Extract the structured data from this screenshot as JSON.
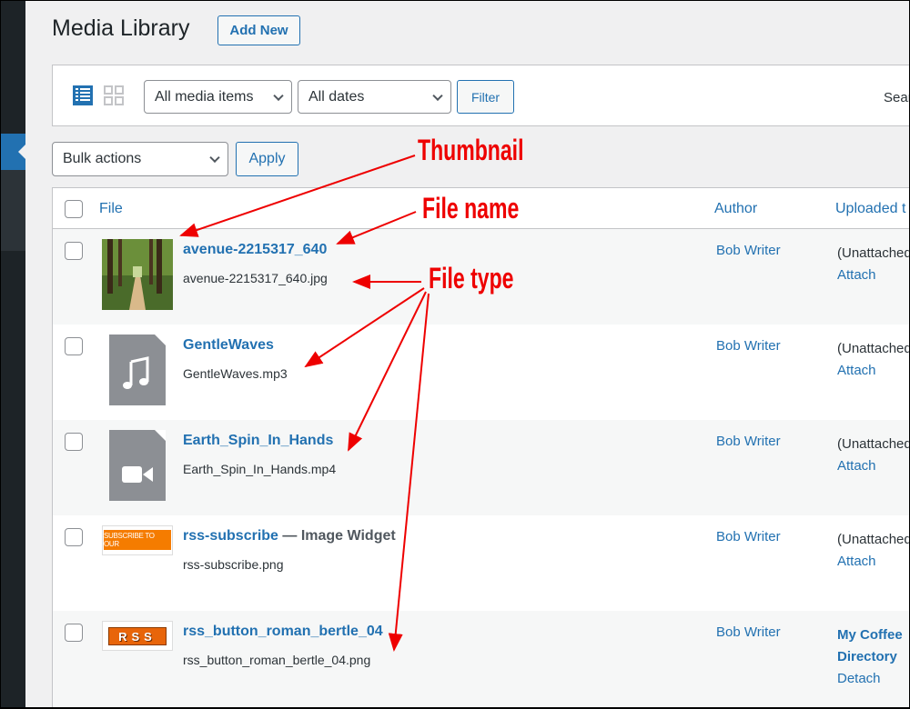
{
  "page_title": "Media Library",
  "add_new": "Add New",
  "filters": {
    "media_type": "All media items",
    "dates": "All dates",
    "filter_button": "Filter",
    "search_label_partial": "Sear"
  },
  "bulk": {
    "select": "Bulk actions",
    "apply": "Apply"
  },
  "table": {
    "columns": {
      "file": "File",
      "author": "Author",
      "uploaded_to": "Uploaded t"
    },
    "rows": [
      {
        "title": "avenue-2215317_640",
        "suffix": "",
        "filename": "avenue-2215317_640.jpg",
        "author": "Bob Writer",
        "uploaded": "(Unattached)",
        "action": "Attach",
        "thumb": "photo"
      },
      {
        "title": "GentleWaves",
        "suffix": "",
        "filename": "GentleWaves.mp3",
        "author": "Bob Writer",
        "uploaded": "(Unattached)",
        "action": "Attach",
        "thumb": "audio-icon"
      },
      {
        "title": "Earth_Spin_In_Hands",
        "suffix": "",
        "filename": "Earth_Spin_In_Hands.mp4",
        "author": "Bob Writer",
        "uploaded": "(Unattached)",
        "action": "Attach",
        "thumb": "video-icon"
      },
      {
        "title": "rss-subscribe",
        "suffix": " — Image Widget",
        "filename": "rss-subscribe.png",
        "author": "Bob Writer",
        "uploaded": "(Unattached)",
        "action": "Attach",
        "thumb": "subscribe-banner",
        "thumb_text": "SUBSCRIBE TO OUR"
      },
      {
        "title": "rss_button_roman_bertle_04",
        "suffix": "",
        "filename": "rss_button_roman_bertle_04.png",
        "author": "Bob Writer",
        "uploaded_line1": "My Coffee",
        "uploaded_line2": "Directory",
        "action": "Detach",
        "thumb": "rss-button",
        "thumb_text": "RSS"
      }
    ]
  },
  "annotations": {
    "thumbnail": "Thumbnail",
    "file_name": "File name",
    "file_type": "File type"
  },
  "colors": {
    "accent": "#2271b1",
    "annotation": "#ee0000",
    "sidebar": "#1d2327"
  }
}
